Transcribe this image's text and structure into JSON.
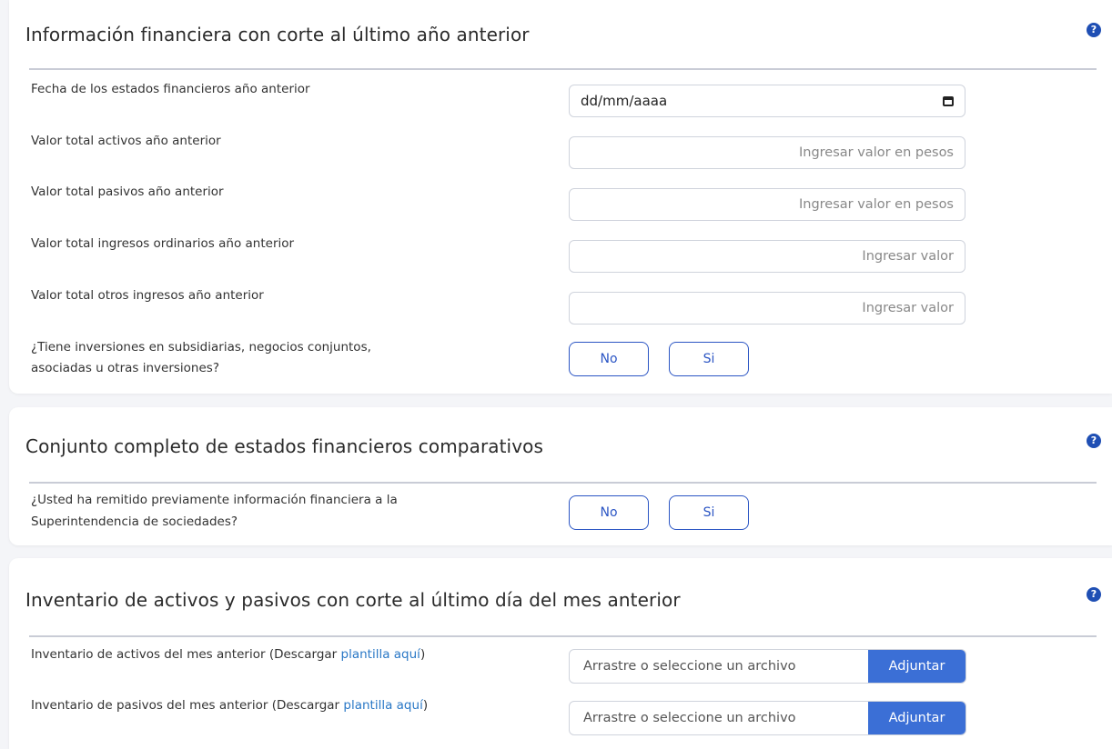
{
  "section1": {
    "title": "Información financiera con corte al último año anterior",
    "help_icon": "?",
    "date_label": "Fecha de los estados financieros año anterior",
    "date_value": "dd/mm/aaaa",
    "assets_label": "Valor total activos año anterior",
    "assets_placeholder": "Ingresar valor en pesos",
    "liabilities_label": "Valor total pasivos año anterior",
    "liabilities_placeholder": "Ingresar valor en pesos",
    "ordinary_income_label": "Valor total ingresos ordinarios año anterior",
    "ordinary_income_placeholder": "Ingresar valor",
    "other_income_label": "Valor total otros ingresos año anterior",
    "other_income_placeholder": "Ingresar valor",
    "investments_question_line1": "¿Tiene inversiones en subsidiarias, negocios conjuntos,",
    "investments_question_line2": "asociadas u otras inversiones?",
    "no_label": "No",
    "yes_label": "Si"
  },
  "section2": {
    "title": "Conjunto completo de estados financieros comparativos",
    "help_icon": "?",
    "question_line1": "¿Usted ha remitido previamente información financiera a la",
    "question_line2": "Superintendencia de sociedades?",
    "no_label": "No",
    "yes_label": "Si"
  },
  "section3": {
    "title": "Inventario de activos y pasivos con corte al último día del mes anterior",
    "help_icon": "?",
    "assets_inventory_label": "Inventario de activos del mes anterior (Descargar ",
    "assets_inventory_link": "plantilla aquí",
    "liabilities_inventory_label": "Inventario de pasivos del mes anterior (Descargar ",
    "liabilities_inventory_link": "plantilla aquí",
    "label_close": ")",
    "file_placeholder": "Arrastre o seleccione un archivo",
    "attach_label": "Adjuntar"
  }
}
